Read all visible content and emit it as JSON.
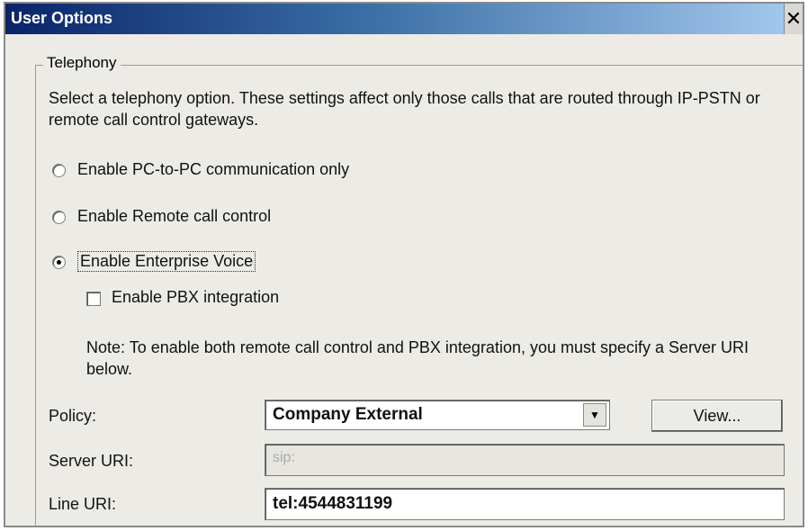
{
  "window": {
    "title": "User Options",
    "close_glyph": "✕"
  },
  "telephony": {
    "legend": "Telephony",
    "description": "Select a telephony option. These settings affect only those calls that are routed through IP-PSTN or remote call control gateways.",
    "options": [
      {
        "label": "Enable PC-to-PC communication only",
        "checked": false
      },
      {
        "label": "Enable Remote call control",
        "checked": false
      },
      {
        "label": "Enable Enterprise Voice",
        "checked": true
      }
    ],
    "pbx": {
      "label": "Enable PBX integration",
      "checked": false
    },
    "note": "Note: To enable both remote call control and PBX integration, you must specify a Server URI below."
  },
  "policy": {
    "label": "Policy:",
    "value": "Company External",
    "view_button": "View..."
  },
  "server_uri": {
    "label": "Server URI:",
    "value": "sip:"
  },
  "line_uri": {
    "label": "Line URI:",
    "value": "tel:4544831199"
  }
}
